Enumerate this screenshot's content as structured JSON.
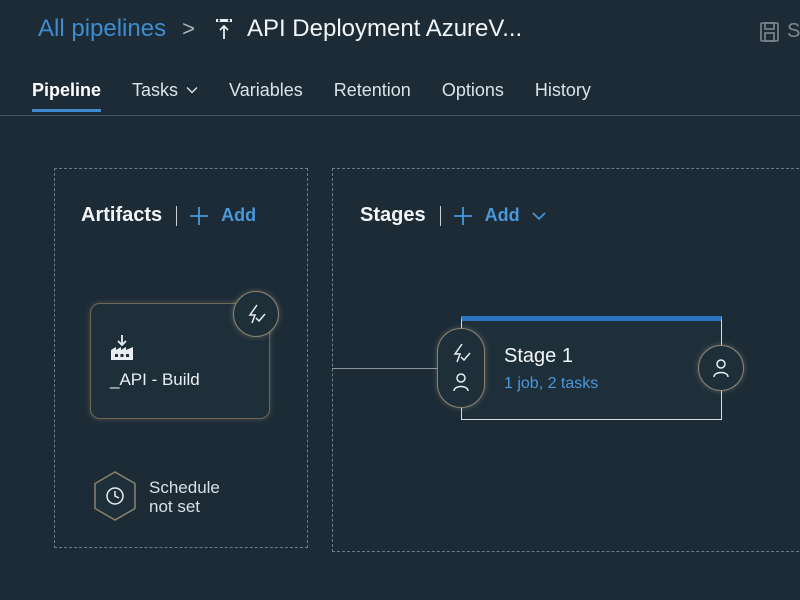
{
  "header": {
    "breadcrumb_link": "All pipelines",
    "breadcrumb_separator": ">",
    "pipeline_title": "API Deployment AzureV...",
    "save_label": "S"
  },
  "tabs": [
    {
      "label": "Pipeline",
      "active": true
    },
    {
      "label": "Tasks",
      "active": false,
      "has_dropdown": true
    },
    {
      "label": "Variables",
      "active": false
    },
    {
      "label": "Retention",
      "active": false
    },
    {
      "label": "Options",
      "active": false
    },
    {
      "label": "History",
      "active": false
    }
  ],
  "artifacts": {
    "title": "Artifacts",
    "add_label": "Add",
    "items": [
      {
        "name": "_API - Build",
        "icon": "build-artifact-icon"
      }
    ],
    "schedule_line1": "Schedule",
    "schedule_line2": "not set"
  },
  "stages": {
    "title": "Stages",
    "add_label": "Add",
    "items": [
      {
        "name": "Stage 1",
        "summary": "1 job, 2 tasks"
      }
    ]
  },
  "colors": {
    "background": "#1c2b36",
    "accent": "#3f8bd0",
    "stage_top_bar": "#2b74c0"
  }
}
